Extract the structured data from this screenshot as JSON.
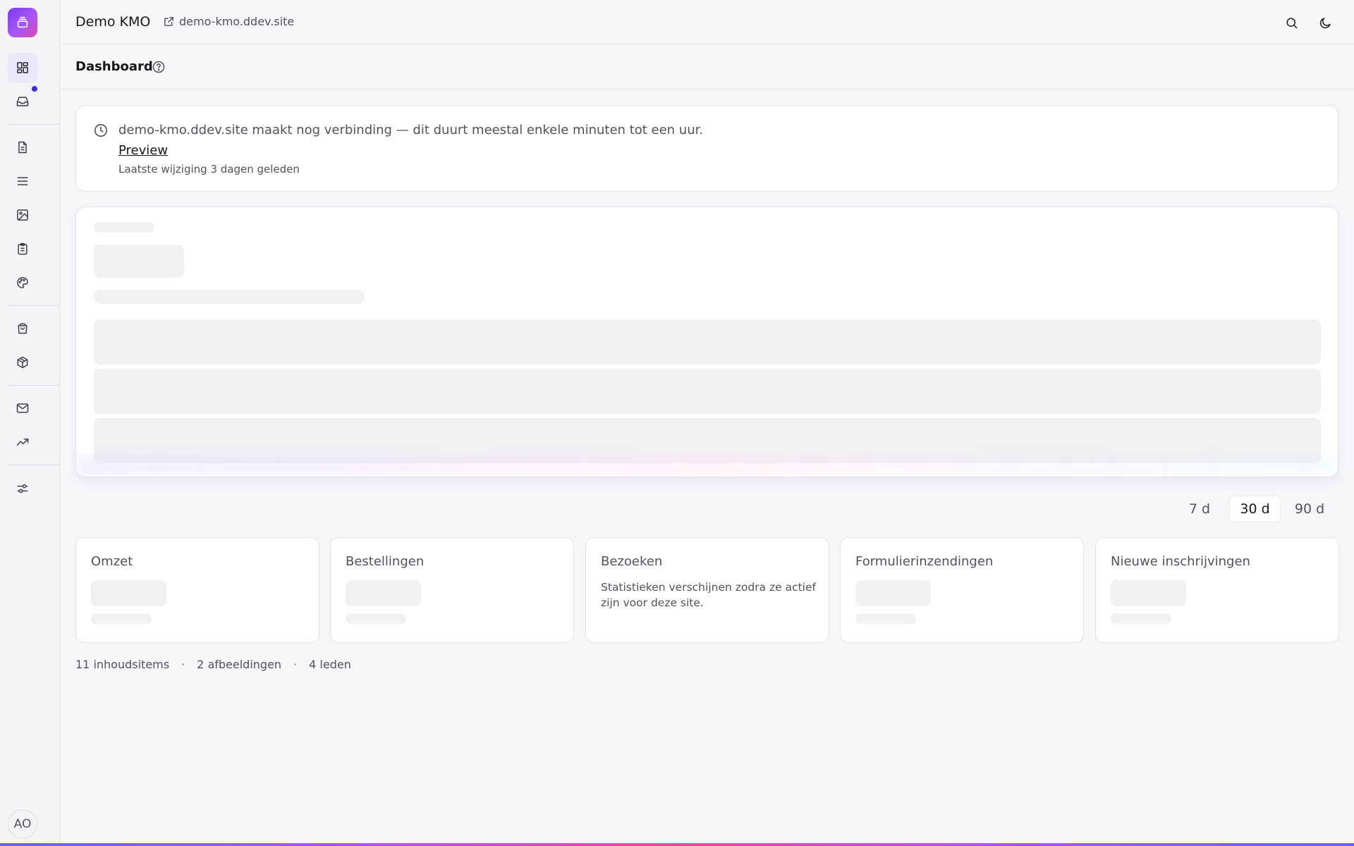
{
  "header": {
    "site_title": "Demo KMO",
    "site_link": "demo-kmo.ddev.site"
  },
  "page": {
    "title": "Dashboard"
  },
  "notice": {
    "message": "demo-kmo.ddev.site maakt nog verbinding — dit duurt meestal enkele minuten tot een uur.",
    "link": "Preview",
    "subtext": "Laatste wijziging 3 dagen geleden"
  },
  "ranges": [
    "7 d",
    "30 d",
    "90 d"
  ],
  "range_selected": "30 d",
  "stats": [
    {
      "label": "Omzet"
    },
    {
      "label": "Bestellingen"
    },
    {
      "label": "Bezoeken",
      "note": "Statistieken verschijnen zodra ze actief zijn voor deze site."
    },
    {
      "label": "Formulierinzendingen"
    },
    {
      "label": "Nieuwe inschrijvingen"
    }
  ],
  "footer": {
    "items": [
      "11 inhoudsitems",
      "2 afbeeldingen",
      "4 leden"
    ],
    "separator": "·"
  },
  "user": {
    "initials": "AO"
  },
  "sidebar": {
    "icons": [
      "dashboard-icon",
      "inbox-icon",
      "page-icon",
      "list-icon",
      "image-icon",
      "clipboard-icon",
      "palette-icon",
      "shopping-bag-icon",
      "package-icon",
      "mail-icon",
      "trending-up-icon",
      "settings-sliders-icon"
    ]
  },
  "colors": {
    "accent": "#3730d9",
    "brand_gradient_start": "#7c3aed",
    "brand_gradient_end": "#ec4899"
  }
}
